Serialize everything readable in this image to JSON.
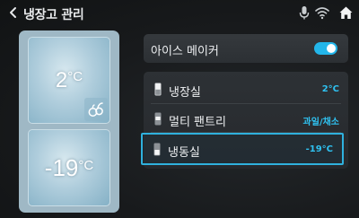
{
  "header": {
    "title": "냉장고 관리",
    "icons": [
      "back-icon",
      "mic-icon",
      "wifi-icon",
      "home-icon"
    ]
  },
  "fridge": {
    "top_compartment": {
      "temperature": "2",
      "unit": "°C",
      "icon": "fruit-vegetable-icon"
    },
    "bottom_compartment": {
      "temperature": "-19",
      "unit": "°C"
    }
  },
  "ice_maker": {
    "label": "아이스 메이커",
    "enabled": true
  },
  "compartments": [
    {
      "label": "냉장실",
      "value": "2°C",
      "icon": "fridge-icon"
    },
    {
      "label": "멀티 팬트리",
      "value": "과일/채소",
      "icon": "pantry-icon"
    },
    {
      "label": "냉동실",
      "value": "-19°C",
      "icon": "freezer-icon",
      "selected": true
    }
  ],
  "colors": {
    "accent": "#2fc1f0",
    "toggle_on": "#23b6ea",
    "background": "#151718",
    "card": "#2c3034"
  }
}
